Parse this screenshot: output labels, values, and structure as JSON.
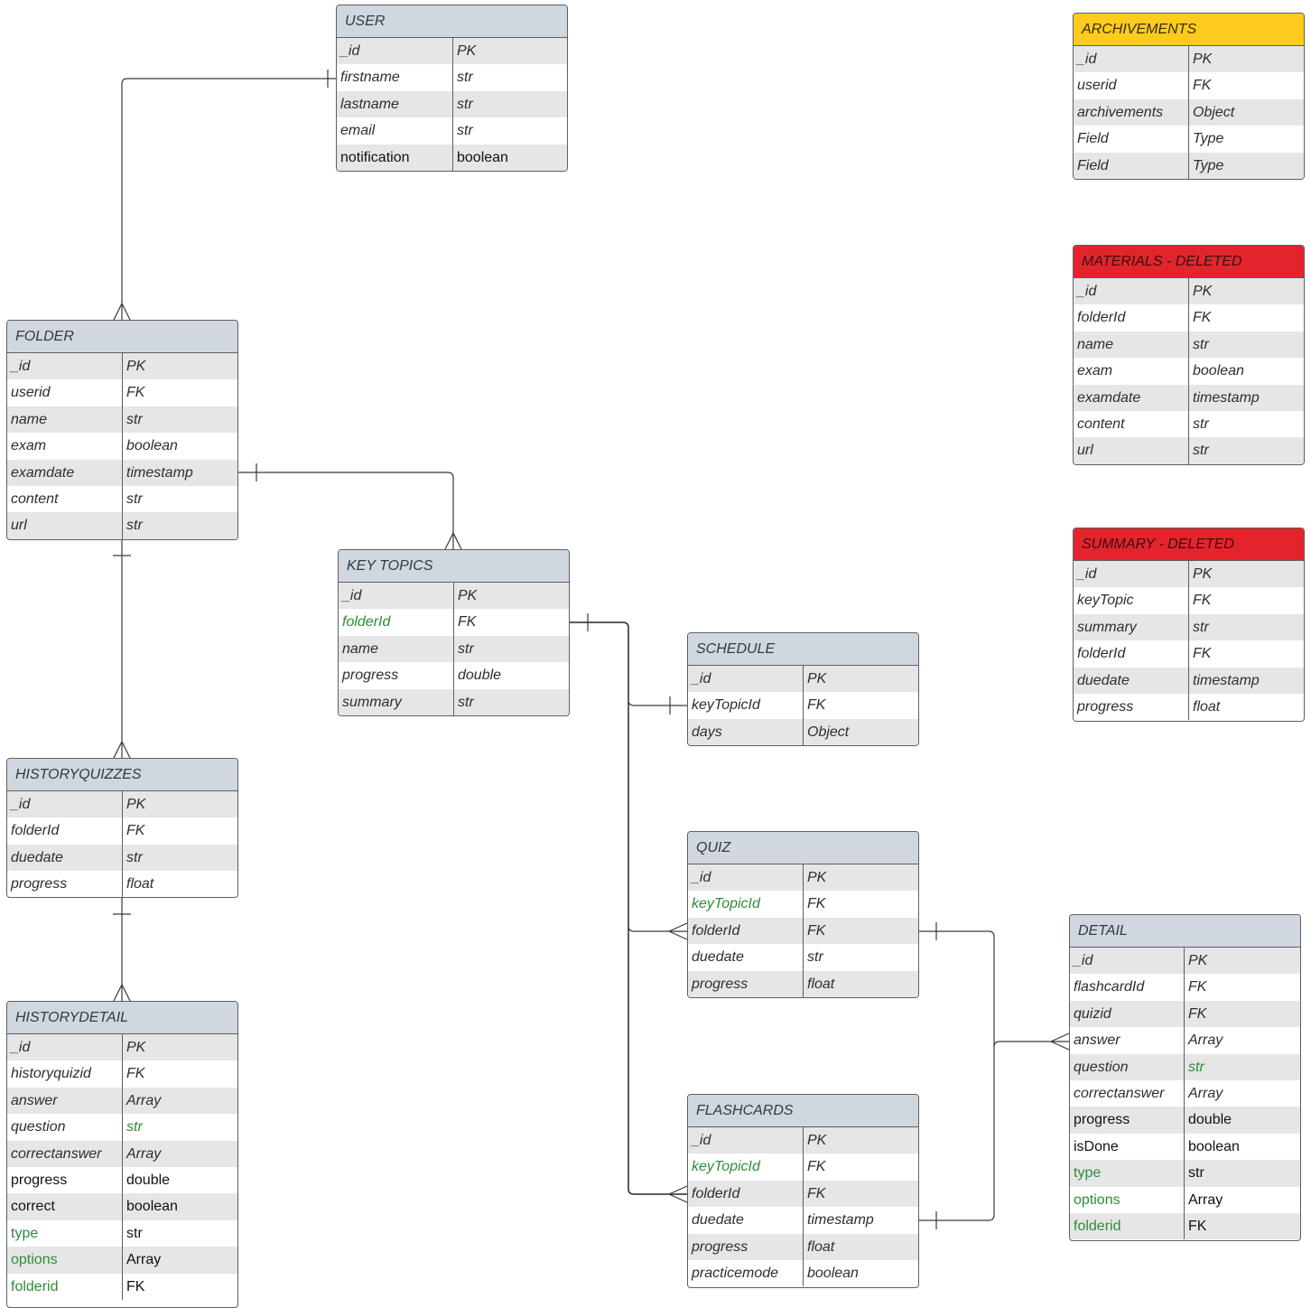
{
  "colors": {
    "header_default": "#d1d7de",
    "header_yellow": "#fccb1e",
    "header_red": "#e4242d",
    "green_text": "#2e8b3a",
    "row_stripe": "#e6e6e6"
  },
  "entities": [
    {
      "key": "user",
      "title": "USER",
      "color": "default",
      "rows": [
        {
          "field": "_id",
          "type": "PK"
        },
        {
          "field": "firstname",
          "type": "str"
        },
        {
          "field": "lastname",
          "type": "str"
        },
        {
          "field": "email",
          "type": "str"
        },
        {
          "field": "notification",
          "type": "boolean",
          "plain": true
        }
      ]
    },
    {
      "key": "archivements",
      "title": "ARCHIVEMENTS",
      "color": "yellow",
      "rows": [
        {
          "field": "_id",
          "type": "PK"
        },
        {
          "field": "userid",
          "type": "FK"
        },
        {
          "field": "archivements",
          "type": "Object"
        },
        {
          "field": "Field",
          "type": "Type"
        },
        {
          "field": "Field",
          "type": "Type"
        }
      ]
    },
    {
      "key": "materials",
      "title": "MATERIALS - DELETED",
      "color": "red",
      "rows": [
        {
          "field": "_id",
          "type": "PK"
        },
        {
          "field": "folderId",
          "type": "FK"
        },
        {
          "field": "name",
          "type": "str"
        },
        {
          "field": "exam",
          "type": "boolean"
        },
        {
          "field": "examdate",
          "type": "timestamp"
        },
        {
          "field": "content",
          "type": "str"
        },
        {
          "field": "url",
          "type": "str"
        }
      ]
    },
    {
      "key": "summary",
      "title": "SUMMARY - DELETED",
      "color": "red",
      "rows": [
        {
          "field": "_id",
          "type": "PK"
        },
        {
          "field": "keyTopic",
          "type": "FK"
        },
        {
          "field": "summary",
          "type": "str"
        },
        {
          "field": "folderId",
          "type": "FK"
        },
        {
          "field": "duedate",
          "type": "timestamp"
        },
        {
          "field": "progress",
          "type": "float"
        }
      ]
    },
    {
      "key": "folder",
      "title": "FOLDER",
      "color": "default",
      "rows": [
        {
          "field": "_id",
          "type": "PK"
        },
        {
          "field": "userid",
          "type": "FK"
        },
        {
          "field": "name",
          "type": "str"
        },
        {
          "field": "exam",
          "type": "boolean"
        },
        {
          "field": "examdate",
          "type": "timestamp"
        },
        {
          "field": "content",
          "type": "str"
        },
        {
          "field": "url",
          "type": "str"
        }
      ]
    },
    {
      "key": "keytopics",
      "title": "KEY TOPICS",
      "color": "default",
      "rows": [
        {
          "field": "_id",
          "type": "PK"
        },
        {
          "field": "folderId",
          "type": "FK",
          "field_green": true
        },
        {
          "field": "name",
          "type": "str"
        },
        {
          "field": "progress",
          "type": "double"
        },
        {
          "field": "summary",
          "type": "str"
        }
      ]
    },
    {
      "key": "schedule",
      "title": "SCHEDULE",
      "color": "default",
      "rows": [
        {
          "field": "_id",
          "type": "PK"
        },
        {
          "field": "keyTopicId",
          "type": "FK"
        },
        {
          "field": "days",
          "type": "Object"
        }
      ]
    },
    {
      "key": "historyquizzes",
      "title": "HISTORYQUIZZES",
      "color": "default",
      "rows": [
        {
          "field": "_id",
          "type": "PK"
        },
        {
          "field": "folderId",
          "type": "FK"
        },
        {
          "field": "duedate",
          "type": "str"
        },
        {
          "field": "progress",
          "type": "float"
        }
      ]
    },
    {
      "key": "quiz",
      "title": "QUIZ",
      "color": "default",
      "rows": [
        {
          "field": "_id",
          "type": "PK"
        },
        {
          "field": "keyTopicId",
          "type": "FK",
          "field_green": true
        },
        {
          "field": "folderId",
          "type": "FK"
        },
        {
          "field": "duedate",
          "type": "str"
        },
        {
          "field": "progress",
          "type": "float"
        }
      ]
    },
    {
      "key": "detail",
      "title": "DETAIL",
      "color": "default",
      "rows": [
        {
          "field": "_id",
          "type": "PK"
        },
        {
          "field": "flashcardId",
          "type": "FK"
        },
        {
          "field": "quizid",
          "type": "FK"
        },
        {
          "field": "answer",
          "type": "Array"
        },
        {
          "field": "question",
          "type": "str",
          "type_green": true
        },
        {
          "field": "correctanswer",
          "type": "Array"
        },
        {
          "field": "progress",
          "type": "double",
          "plain": true
        },
        {
          "field": "isDone",
          "type": "boolean",
          "plain": true
        },
        {
          "field": "type",
          "type": "str",
          "plain": true,
          "field_green": true
        },
        {
          "field": "options",
          "type": "Array",
          "plain": true,
          "field_green": true
        },
        {
          "field": "folderid",
          "type": "FK",
          "plain": true,
          "field_green": true
        }
      ]
    },
    {
      "key": "historydetail",
      "title": "HISTORYDETAIL",
      "color": "default",
      "rows": [
        {
          "field": "_id",
          "type": "PK"
        },
        {
          "field": "historyquizid",
          "type": "FK"
        },
        {
          "field": "answer",
          "type": "Array"
        },
        {
          "field": "question",
          "type": "str",
          "type_green": true
        },
        {
          "field": "correctanswer",
          "type": "Array"
        },
        {
          "field": "progress",
          "type": "double",
          "plain": true
        },
        {
          "field": "correct",
          "type": "boolean",
          "plain": true
        },
        {
          "field": "type",
          "type": "str",
          "plain": true,
          "field_green": true
        },
        {
          "field": "options",
          "type": "Array",
          "plain": true,
          "field_green": true
        },
        {
          "field": "folderid",
          "type": "FK",
          "plain": true,
          "field_green": true
        }
      ]
    },
    {
      "key": "flashcards",
      "title": "FLASHCARDS",
      "color": "default",
      "rows": [
        {
          "field": "_id",
          "type": "PK"
        },
        {
          "field": "keyTopicId",
          "type": "FK",
          "field_green": true
        },
        {
          "field": "folderId",
          "type": "FK"
        },
        {
          "field": "duedate",
          "type": "timestamp"
        },
        {
          "field": "progress",
          "type": "float"
        },
        {
          "field": "practicemode",
          "type": "boolean"
        }
      ]
    }
  ],
  "relationships": [
    {
      "from": "user",
      "to": "folder",
      "from_cardinality": "one",
      "to_cardinality": "many"
    },
    {
      "from": "folder",
      "to": "keytopics",
      "from_cardinality": "one",
      "to_cardinality": "many"
    },
    {
      "from": "folder",
      "to": "historyquizzes",
      "from_cardinality": "one",
      "to_cardinality": "many"
    },
    {
      "from": "historyquizzes",
      "to": "historydetail",
      "from_cardinality": "one",
      "to_cardinality": "many"
    },
    {
      "from": "keytopics",
      "to": "schedule",
      "from_cardinality": "one",
      "to_cardinality": "one"
    },
    {
      "from": "keytopics",
      "to": "quiz",
      "from_cardinality": "one",
      "to_cardinality": "many"
    },
    {
      "from": "keytopics",
      "to": "flashcards",
      "from_cardinality": "one",
      "to_cardinality": "many"
    },
    {
      "from": "quiz",
      "to": "detail",
      "from_cardinality": "one",
      "to_cardinality": "many"
    },
    {
      "from": "flashcards",
      "to": "detail",
      "from_cardinality": "one",
      "to_cardinality": "many"
    }
  ]
}
